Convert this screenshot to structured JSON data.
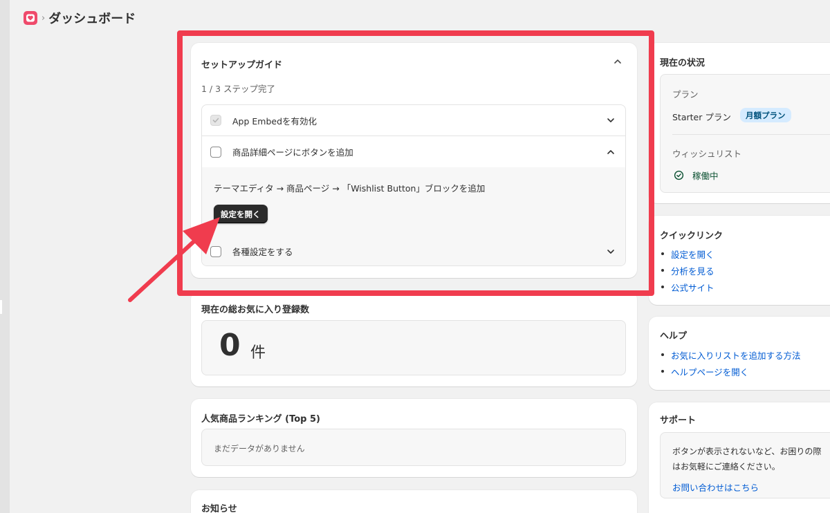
{
  "header": {
    "separator": "›",
    "title": "ダッシュボード"
  },
  "setup_guide": {
    "title": "セットアップガイド",
    "progress": "1 / 3 ステップ完了",
    "steps": [
      {
        "label": "App Embedを有効化",
        "completed": true,
        "expanded": false
      },
      {
        "label": "商品詳細ページにボタンを追加",
        "completed": false,
        "expanded": true,
        "description": "テーマエディタ → 商品ページ → 「Wishlist Button」ブロックを追加",
        "button_label": "設定を開く"
      },
      {
        "label": "各種設定をする",
        "completed": false,
        "expanded": false
      }
    ]
  },
  "favorites": {
    "title": "現在の総お気に入り登録数",
    "count": "0",
    "unit": "件"
  },
  "ranking": {
    "title": "人気商品ランキング (Top 5)",
    "empty_text": "まだデータがありません"
  },
  "news": {
    "title": "お知らせ"
  },
  "status": {
    "title": "現在の状況",
    "plan_label": "プラン",
    "plan_name": "Starter プラン",
    "plan_badge": "月額プラン",
    "wishlist_label": "ウィッシュリスト",
    "wishlist_status": "稼働中"
  },
  "quick_links": {
    "title": "クイックリンク",
    "items": [
      "設定を開く",
      "分析を見る",
      "公式サイト"
    ]
  },
  "help": {
    "title": "ヘルプ",
    "items": [
      "お気に入りリストを追加する方法",
      "ヘルプページを開く"
    ]
  },
  "support": {
    "title": "サポート",
    "text_line1": "ボタンが表示されないなど、お困りの際",
    "text_line2": "はお気軽にご連絡ください。",
    "link": "お問い合わせはこちら"
  },
  "colors": {
    "highlight": "#f03c4e",
    "link": "#005bd3",
    "badge_bg": "#d5ebff",
    "status_ok": "#0c5132",
    "logo": "#ef4a6b"
  }
}
